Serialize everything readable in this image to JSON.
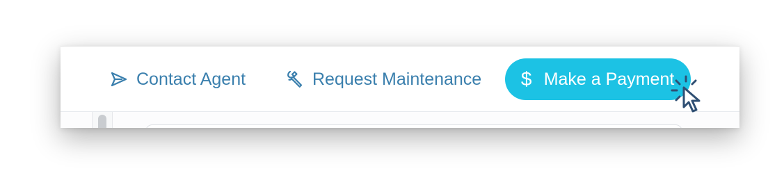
{
  "toolbar": {
    "contact_agent": {
      "label": "Contact Agent",
      "icon": "paper-plane-icon"
    },
    "request_maintenance": {
      "label": "Request Maintenance",
      "icon": "wrench-icon"
    },
    "make_payment": {
      "label": "Make a Payment",
      "icon": "dollar-icon",
      "icon_glyph": "$"
    }
  },
  "colors": {
    "link": "#3a7fad",
    "payment_button": "#1cc2e4",
    "payment_text": "#ffffff",
    "cursor": "#2f4f73"
  },
  "cursor": {
    "icon": "hand-pointer-click-icon"
  }
}
